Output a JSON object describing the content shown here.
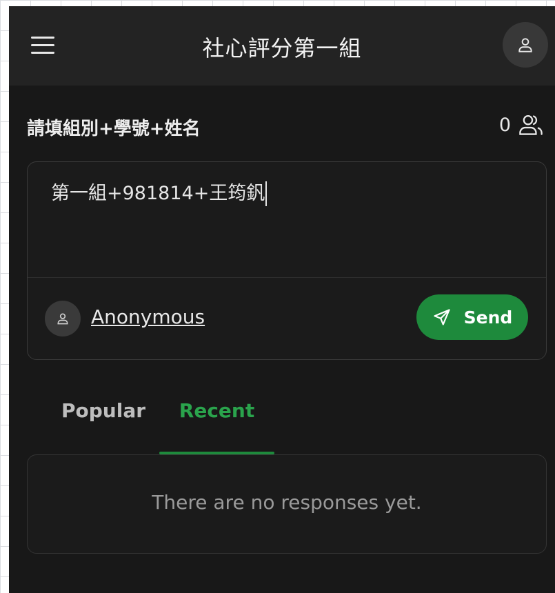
{
  "header": {
    "title": "社心評分第一組",
    "menu_icon": "hamburger-menu-icon",
    "profile_icon": "user-icon"
  },
  "prompt": {
    "label": "請填組別+學號+姓名",
    "participant_count": "0",
    "participants_icon": "users-icon"
  },
  "composer": {
    "input_value": "第一組+981814+王筠釩",
    "author_name": "Anonymous",
    "author_icon": "user-icon",
    "send_label": "Send",
    "send_icon": "paper-plane-icon"
  },
  "tabs": [
    {
      "label": "Popular",
      "active": false
    },
    {
      "label": "Recent",
      "active": true
    }
  ],
  "responses": {
    "empty_message": "There are no responses yet."
  },
  "colors": {
    "background": "#181818",
    "header_bg": "#232323",
    "accent_green": "#1e8a3c",
    "accent_green_text": "#2aa34c"
  }
}
